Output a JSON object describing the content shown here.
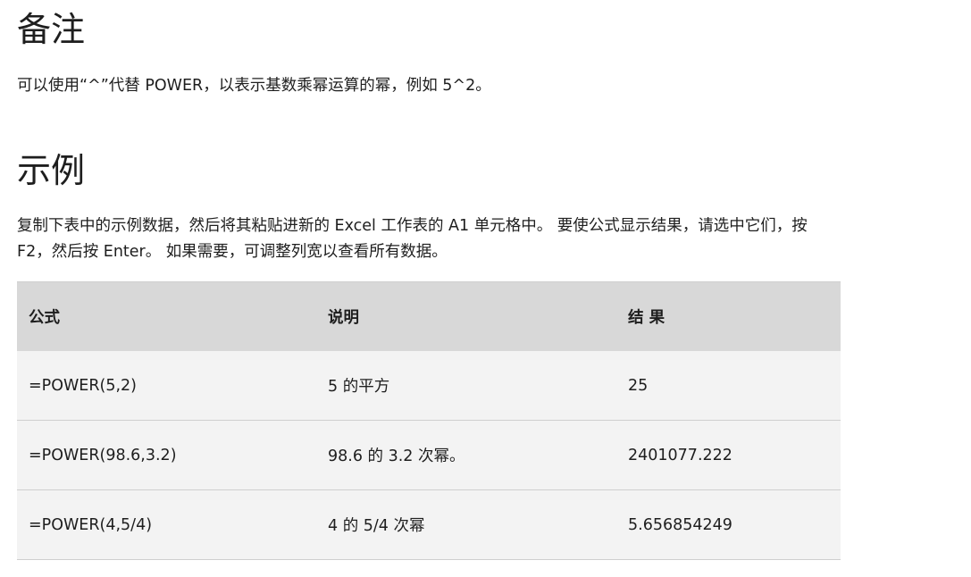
{
  "notes": {
    "heading": "备注",
    "text": "可以使用“^”代替 POWER，以表示基数乘幂运算的幂，例如 5^2。"
  },
  "examples": {
    "heading": "示例",
    "text": "复制下表中的示例数据，然后将其粘贴进新的 Excel 工作表的 A1 单元格中。 要使公式显示结果，请选中它们，按 F2，然后按 Enter。 如果需要，可调整列宽以查看所有数据。"
  },
  "table": {
    "headers": [
      "公式",
      "说明",
      "结 果"
    ],
    "rows": [
      [
        "=POWER(5,2)",
        "5 的平方",
        "25"
      ],
      [
        "=POWER(98.6,3.2)",
        "98.6 的 3.2 次幂。",
        "2401077.222"
      ],
      [
        "=POWER(4,5/4)",
        "4 的 5/4 次幂",
        "5.656854249"
      ]
    ]
  }
}
